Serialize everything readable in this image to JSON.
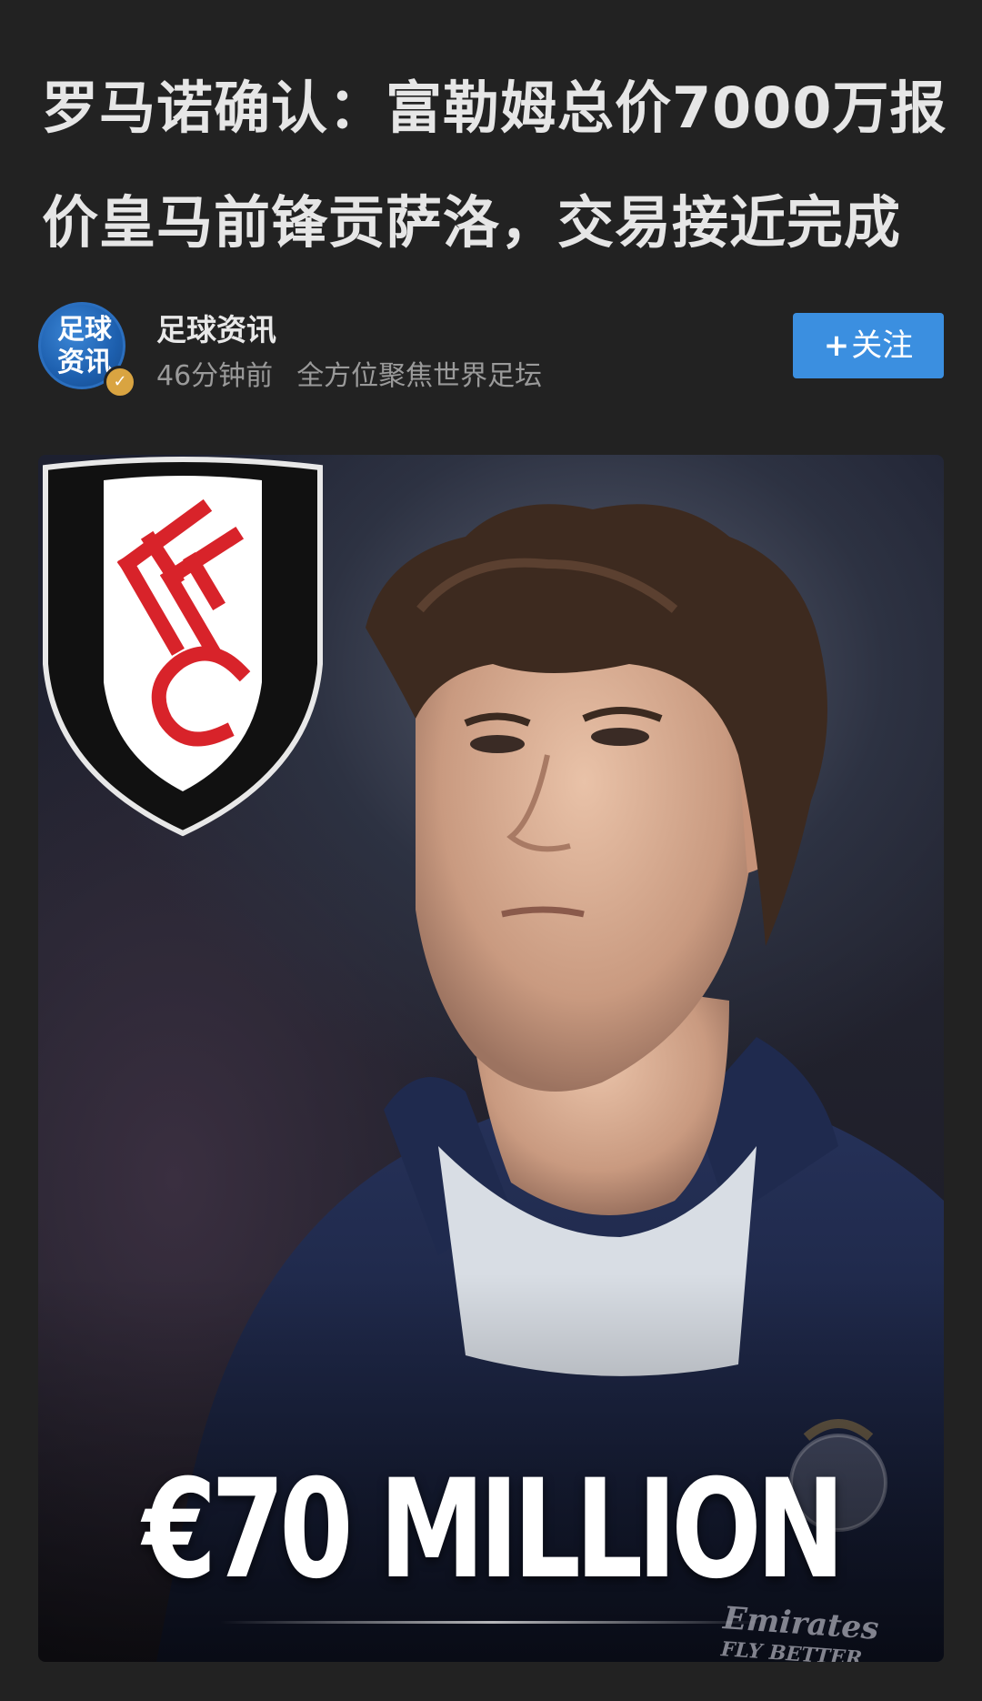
{
  "article": {
    "title_line1": "罗马诺确认：富勒姆总价7000万报",
    "title_line2": "价皇马前锋贡萨洛，交易接近完成"
  },
  "author": {
    "avatar_text": "足球资讯",
    "name": "足球资讯",
    "time": "46分钟前",
    "slogan": "全方位聚焦世界足坛",
    "follow_plus": "+",
    "follow_label": "关注"
  },
  "hero_image": {
    "crest_letters": "FFC",
    "headline": "€70 MILLION",
    "sponsor_text": "Emirates",
    "sponsor_sub": "FLY BETTER"
  },
  "colors": {
    "background": "#222222",
    "follow_button": "#3b8fe0",
    "crest_red": "#d8232a"
  }
}
